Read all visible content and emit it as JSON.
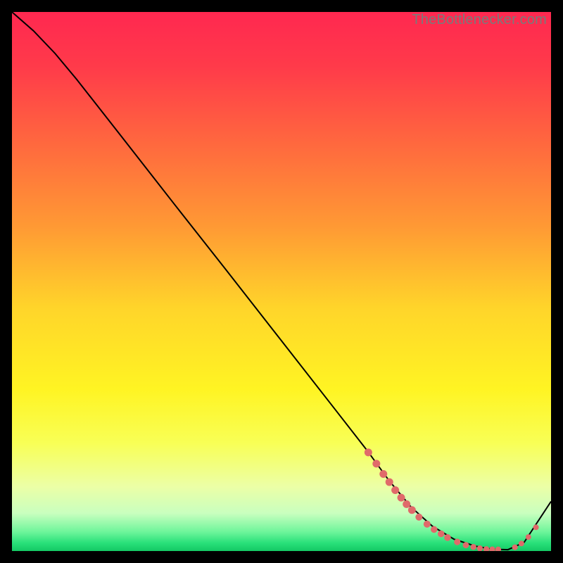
{
  "watermark": "TheBottlenecker.com",
  "chart_data": {
    "type": "line",
    "title": "",
    "xlabel": "",
    "ylabel": "",
    "xlim": [
      0,
      100
    ],
    "ylim": [
      0,
      100
    ],
    "background_gradient": {
      "stops": [
        {
          "offset": 0.0,
          "color": "#ff2850"
        },
        {
          "offset": 0.1,
          "color": "#ff3a4a"
        },
        {
          "offset": 0.25,
          "color": "#ff6a3e"
        },
        {
          "offset": 0.4,
          "color": "#ff9a34"
        },
        {
          "offset": 0.55,
          "color": "#ffd52a"
        },
        {
          "offset": 0.7,
          "color": "#fff423"
        },
        {
          "offset": 0.8,
          "color": "#f8ff56"
        },
        {
          "offset": 0.88,
          "color": "#ecffa6"
        },
        {
          "offset": 0.93,
          "color": "#c9ffbf"
        },
        {
          "offset": 0.965,
          "color": "#6cf59a"
        },
        {
          "offset": 0.985,
          "color": "#29e07a"
        },
        {
          "offset": 1.0,
          "color": "#14c964"
        }
      ]
    },
    "series": [
      {
        "name": "curve",
        "color": "#000000",
        "x": [
          0,
          4,
          8,
          12,
          20,
          30,
          40,
          50,
          60,
          66,
          70,
          74,
          78,
          82,
          86,
          89,
          92,
          95,
          100
        ],
        "y": [
          100,
          96.5,
          92.3,
          87.5,
          77.3,
          64.5,
          51.8,
          39.0,
          26.2,
          18.5,
          13.0,
          8.2,
          4.6,
          2.2,
          0.9,
          0.35,
          0.25,
          1.6,
          9.2
        ]
      }
    ],
    "markers": {
      "color": "#e06a6a",
      "points": [
        {
          "x": 66.1,
          "y": 18.3,
          "r": 5.5
        },
        {
          "x": 67.6,
          "y": 16.2,
          "r": 5.5
        },
        {
          "x": 68.9,
          "y": 14.3,
          "r": 5.5
        },
        {
          "x": 70.0,
          "y": 12.8,
          "r": 5.5
        },
        {
          "x": 71.1,
          "y": 11.3,
          "r": 5.5
        },
        {
          "x": 72.2,
          "y": 9.9,
          "r": 5.5
        },
        {
          "x": 73.2,
          "y": 8.7,
          "r": 5.5
        },
        {
          "x": 74.2,
          "y": 7.6,
          "r": 5.5
        },
        {
          "x": 75.5,
          "y": 6.3,
          "r": 5.0
        },
        {
          "x": 77.0,
          "y": 5.0,
          "r": 5.0
        },
        {
          "x": 78.3,
          "y": 4.0,
          "r": 4.8
        },
        {
          "x": 79.6,
          "y": 3.2,
          "r": 4.8
        },
        {
          "x": 80.8,
          "y": 2.5,
          "r": 4.8
        },
        {
          "x": 82.6,
          "y": 1.7,
          "r": 4.6
        },
        {
          "x": 84.2,
          "y": 1.1,
          "r": 4.4
        },
        {
          "x": 85.6,
          "y": 0.75,
          "r": 4.2
        },
        {
          "x": 86.8,
          "y": 0.5,
          "r": 4.2
        },
        {
          "x": 88.0,
          "y": 0.35,
          "r": 4.2
        },
        {
          "x": 89.1,
          "y": 0.3,
          "r": 4.2
        },
        {
          "x": 90.2,
          "y": 0.28,
          "r": 4.2
        },
        {
          "x": 93.3,
          "y": 0.7,
          "r": 4.0
        },
        {
          "x": 94.5,
          "y": 1.4,
          "r": 4.0
        },
        {
          "x": 95.8,
          "y": 2.6,
          "r": 4.0
        },
        {
          "x": 97.2,
          "y": 4.4,
          "r": 4.0
        }
      ]
    }
  }
}
